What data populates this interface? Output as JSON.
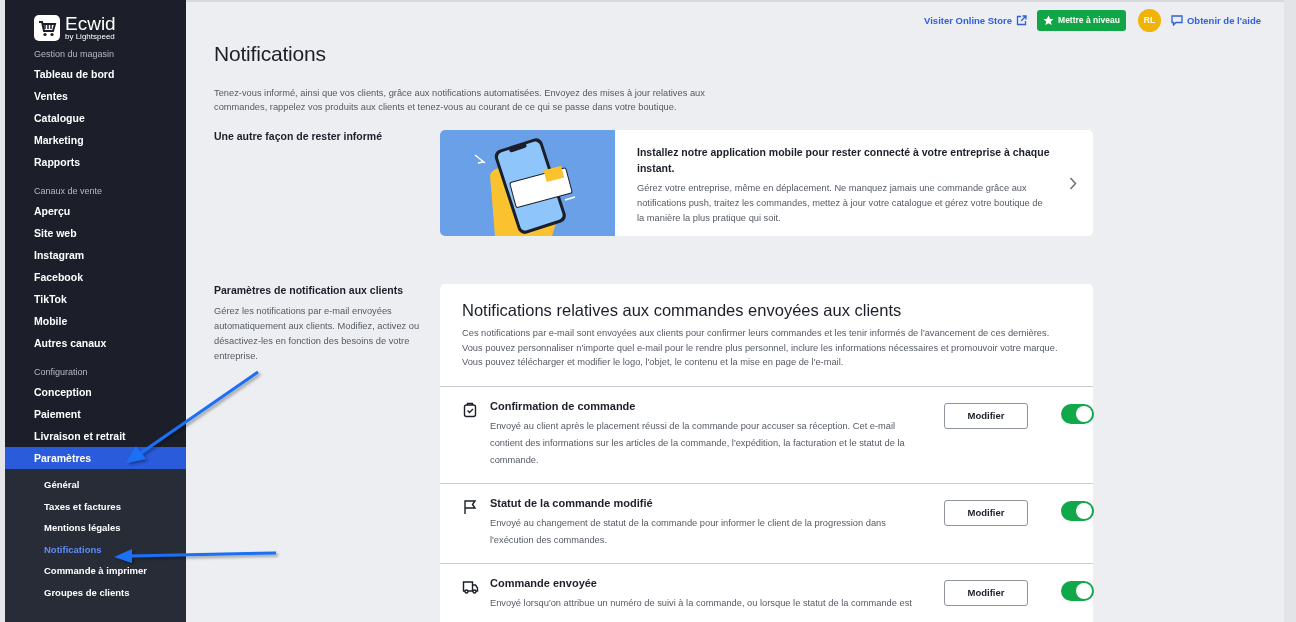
{
  "sidebar": {
    "logo": {
      "name": "Ecwid",
      "tagline": "by Lightspeed"
    },
    "sections": [
      {
        "heading": "Gestion du magasin",
        "items": [
          {
            "label": "Tableau de bord",
            "selected": false
          },
          {
            "label": "Ventes",
            "selected": false
          },
          {
            "label": "Catalogue",
            "selected": false
          },
          {
            "label": "Marketing",
            "selected": false
          },
          {
            "label": "Rapports",
            "selected": false
          }
        ]
      },
      {
        "heading": "Canaux de vente",
        "items": [
          {
            "label": "Aperçu",
            "selected": false
          },
          {
            "label": "Site web",
            "selected": false
          },
          {
            "label": "Instagram",
            "selected": false
          },
          {
            "label": "Facebook",
            "selected": false
          },
          {
            "label": "TikTok",
            "selected": false
          },
          {
            "label": "Mobile",
            "selected": false
          },
          {
            "label": "Autres canaux",
            "selected": false
          }
        ]
      },
      {
        "heading": "Configuration",
        "items": [
          {
            "label": "Conception",
            "selected": false
          },
          {
            "label": "Paiement",
            "selected": false
          },
          {
            "label": "Livraison et retrait",
            "selected": false
          },
          {
            "label": "Paramètres",
            "selected": true,
            "expanded": true,
            "children": [
              {
                "label": "Général",
                "selected": false
              },
              {
                "label": "Taxes et factures",
                "selected": false
              },
              {
                "label": "Mentions légales",
                "selected": false
              },
              {
                "label": "Notifications",
                "selected": true
              },
              {
                "label": "Commande à imprimer",
                "selected": false
              },
              {
                "label": "Groupes de clients",
                "selected": false
              }
            ]
          }
        ]
      }
    ]
  },
  "topbar": {
    "store_link": "Visiter Online Store",
    "upgrade_button": "Mettre à niveau",
    "avatar": "RL",
    "help_link": "Obtenir de l'aide"
  },
  "page": {
    "title": "Notifications",
    "description": "Tenez-vous informé, ainsi que vos clients, grâce aux notifications automatisées. Envoyez des mises à jour relatives aux commandes, rappelez vos produits aux clients et tenez-vous au courant de ce qui se passe dans votre boutique."
  },
  "promo": {
    "heading": "Une autre façon de rester informé",
    "title": "Installez notre application mobile pour rester connecté à votre entreprise à chaque instant.",
    "text": "Gérez votre entreprise, même en déplacement. Ne manquez jamais une commande grâce aux notifications push, traitez les commandes, mettez à jour votre catalogue et gérez votre boutique de la manière la plus pratique qui soit."
  },
  "customer_notifications": {
    "heading": "Paramètres de notification aux clients",
    "text": "Gérez les notifications par e-mail envoyées automatiquement aux clients. Modifiez, activez ou désactivez-les en fonction des besoins de votre entreprise.",
    "card": {
      "title": "Notifications relatives aux commandes envoyées aux clients",
      "text": "Ces notifications par e-mail sont envoyées aux clients pour confirmer leurs commandes et les tenir informés de l'avancement de ces dernières. Vous pouvez personnaliser n'importe quel e-mail pour le rendre plus personnel, inclure les informations nécessaires et promouvoir votre marque. Vous pouvez télécharger et modifier le logo, l'objet, le contenu et la mise en page de l'e-mail.",
      "items": [
        {
          "kind": "clipboard",
          "title": "Confirmation de commande",
          "text": "Envoyé au client après le placement réussi de la commande pour accuser sa réception. Cet e-mail contient des informations sur les articles de la commande, l'expédition, la facturation et le statut de la commande.",
          "button": "Modifier",
          "on": true
        },
        {
          "kind": "flag",
          "title": "Statut de la commande modifié",
          "text": "Envoyé au changement de statut de la commande pour informer le client de la progression dans l'exécution des commandes.",
          "button": "Modifier",
          "on": true
        },
        {
          "kind": "truck",
          "title": "Commande envoyée",
          "text": "Envoyé lorsqu'on attribue un numéro de suivi à la commande, ou lorsque le statut de la commande est",
          "button": "Modifier",
          "on": true
        }
      ]
    }
  }
}
